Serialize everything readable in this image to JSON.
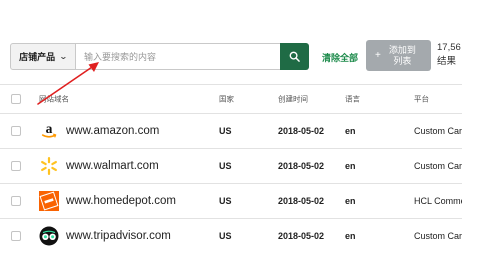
{
  "toolbar": {
    "store_select_label": "店铺产品",
    "search_placeholder": "输入要搜索的内容",
    "clear_all_label": "清除全部",
    "add_to_list_line1": "添加到",
    "add_to_list_line2": "列表",
    "count_value": "17,56",
    "count_unit": "结果"
  },
  "table": {
    "headers": {
      "site": "网站域名",
      "country": "国家",
      "created": "创建时间",
      "language": "语言",
      "platform": "平台"
    },
    "rows": [
      {
        "site": "www.amazon.com",
        "logo_icon": "amazon-logo-icon",
        "country": "US",
        "created": "2018-05-02",
        "language": "en",
        "platform": "Custom Car"
      },
      {
        "site": "www.walmart.com",
        "logo_icon": "walmart-spark-icon",
        "country": "US",
        "created": "2018-05-02",
        "language": "en",
        "platform": "Custom Car"
      },
      {
        "site": "www.homedepot.com",
        "logo_icon": "homedepot-logo-icon",
        "country": "US",
        "created": "2018-05-02",
        "language": "en",
        "platform": "HCL Comme"
      },
      {
        "site": "www.tripadvisor.com",
        "logo_icon": "tripadvisor-owl-icon",
        "country": "US",
        "created": "2018-05-02",
        "language": "en",
        "platform": "Custom Car"
      }
    ]
  },
  "colors": {
    "search_button": "#1f6b45",
    "clear_all": "#1b8a4a",
    "add_list_button": "#a4a9ad",
    "annotation_arrow": "#e02020",
    "homedepot_orange": "#f96302",
    "walmart_yellow": "#ffc220",
    "tripadvisor_green": "#34e0a1"
  }
}
